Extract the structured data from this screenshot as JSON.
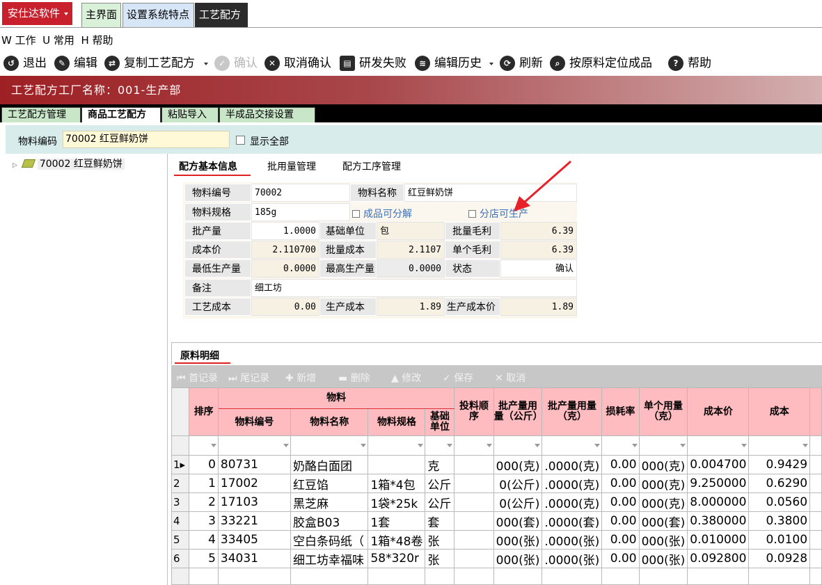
{
  "top": {
    "brand": "安仕达软件",
    "tabs": [
      "主界面",
      "设置系统特点",
      "工艺配方"
    ]
  },
  "menu": [
    "W 工作",
    "U 常用",
    "H 帮助"
  ],
  "toolbar": {
    "exit": "退出",
    "edit": "编辑",
    "copy": "复制工艺配方",
    "confirm": "确认",
    "cancel_confirm": "取消确认",
    "rd_fail": "研发失败",
    "edit_history": "编辑历史",
    "refresh": "刷新",
    "locate": "按原料定位成品",
    "help": "帮助"
  },
  "banner": "工艺配方工厂名称：001-生产部",
  "subtabs": [
    "工艺配方管理",
    "商品工艺配方",
    "粘贴导入",
    "半成品交接设置"
  ],
  "filter": {
    "label": "物料编码",
    "value": "70002 红豆鲜奶饼",
    "show_all": "显示全部"
  },
  "tree": {
    "node": "70002 红豆鲜奶饼"
  },
  "detail_tabs": [
    "配方基本信息",
    "批用量管理",
    "配方工序管理"
  ],
  "form": {
    "code_label": "物料编号",
    "code": "70002",
    "name_label": "物料名称",
    "name": "红豆鲜奶饼",
    "spec_label": "物料规格",
    "spec": "185g",
    "decomposable": "成品可分解",
    "branch_produce": "分店可生产",
    "batch_qty_label": "批产量",
    "batch_qty": "1.0000",
    "base_unit_label": "基础单位",
    "base_unit": "包",
    "batch_profit_label": "批量毛利",
    "batch_profit": "6.39",
    "cost_price_label": "成本价",
    "cost_price": "2.110700",
    "batch_cost_label": "批量成本",
    "batch_cost": "2.1107",
    "unit_profit_label": "单个毛利",
    "unit_profit": "6.39",
    "min_qty_label": "最低生产量",
    "min_qty": "0.0000",
    "max_qty_label": "最高生产量",
    "max_qty": "0.0000",
    "status_label": "状态",
    "status": "确认",
    "remark_label": "备注",
    "remark": "细工坊",
    "process_cost_label": "工艺成本",
    "process_cost": "0.00",
    "prod_cost_label": "生产成本",
    "prod_cost": "1.89",
    "prod_cost_price_label": "生产成本价",
    "prod_cost_price": "1.89"
  },
  "grid": {
    "title": "原料明细",
    "nav": [
      "首记录",
      "尾记录",
      "新增",
      "删除",
      "修改",
      "保存",
      "取消"
    ],
    "headers": {
      "seq": "排序",
      "material": "物料",
      "code": "物料编号",
      "name": "物料名称",
      "spec": "物料规格",
      "unit": "基础单位",
      "order": "投料顺序",
      "batch_kg": "批产量用量（公斤）",
      "batch_g": "批产量用量（克）",
      "loss": "损耗率",
      "single": "单个用量（克）",
      "cost_price": "成本价",
      "cost": "成本"
    },
    "rows": [
      {
        "idx": "1",
        "seq": "0",
        "code": "80731",
        "name": "奶酪白面团",
        "spec": "",
        "unit": "克",
        "order": "",
        "kg": "000(克)",
        "g": ".0000(克)",
        "loss": "0.00",
        "single": "000(克)",
        "cprice": "0.004700",
        "cost": "0.9429"
      },
      {
        "idx": "2",
        "seq": "1",
        "code": "17002",
        "name": "红豆馅",
        "spec": "1箱*4包",
        "unit": "公斤",
        "order": "",
        "kg": "0(公斤)",
        "g": ".0000(克)",
        "loss": "0.00",
        "single": "000(克)",
        "cprice": "9.250000",
        "cost": "0.6290"
      },
      {
        "idx": "3",
        "seq": "2",
        "code": "17103",
        "name": "黑芝麻",
        "spec": "1袋*25k",
        "unit": "公斤",
        "order": "",
        "kg": "0(公斤)",
        "g": ".0000(克)",
        "loss": "0.00",
        "single": "000(克)",
        "cprice": "8.000000",
        "cost": "0.0560"
      },
      {
        "idx": "4",
        "seq": "3",
        "code": "33221",
        "name": "胶盒B03",
        "spec": "1套",
        "unit": "套",
        "order": "",
        "kg": "000(套)",
        "g": ".0000(套)",
        "loss": "0.00",
        "single": "000(套)",
        "cprice": "0.380000",
        "cost": "0.3800"
      },
      {
        "idx": "5",
        "seq": "4",
        "code": "33405",
        "name": "空白条码纸（",
        "spec": "1箱*48卷",
        "unit": "张",
        "order": "",
        "kg": "000(张)",
        "g": ".0000(张)",
        "loss": "0.00",
        "single": "000(张)",
        "cprice": "0.010000",
        "cost": "0.0100"
      },
      {
        "idx": "6",
        "seq": "5",
        "code": "34031",
        "name": "细工坊幸福味",
        "spec": "58*320r",
        "unit": "张",
        "order": "",
        "kg": "000(张)",
        "g": ".0000(张)",
        "loss": "0.00",
        "single": "000(张)",
        "cprice": "0.092800",
        "cost": "0.0928"
      }
    ]
  }
}
